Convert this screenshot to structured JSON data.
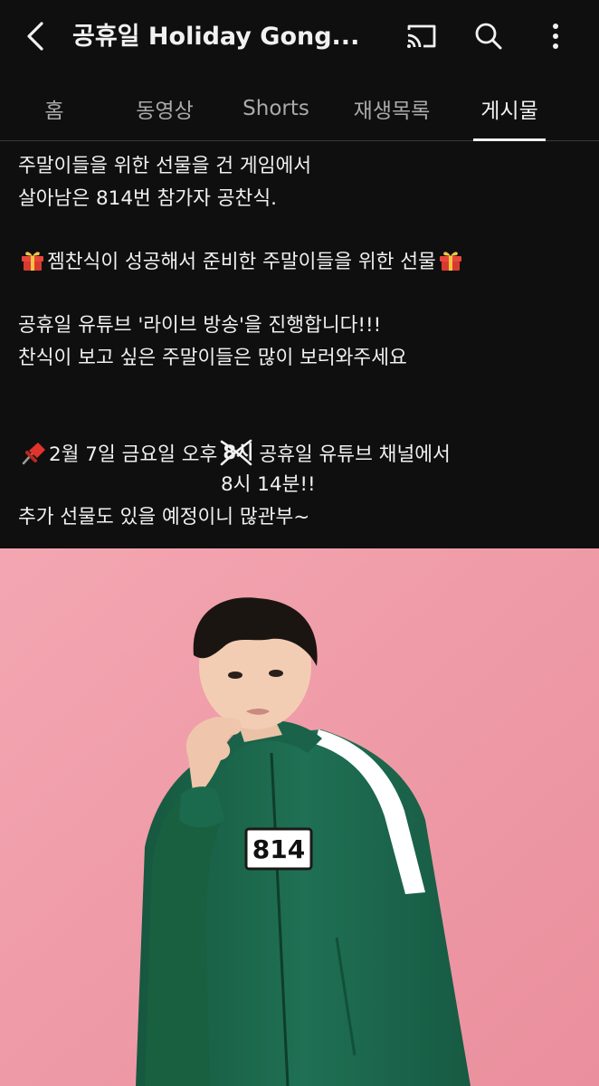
{
  "appbar": {
    "title": "공휴일 Holiday Gong...",
    "icons": [
      "back-arrow-icon",
      "cast-icon",
      "search-icon",
      "more-vert-icon"
    ]
  },
  "tabs": [
    {
      "label": "홈",
      "active": false
    },
    {
      "label": "동영상",
      "active": false
    },
    {
      "label": "Shorts",
      "active": false
    },
    {
      "label": "재생목록",
      "active": false
    },
    {
      "label": "게시물",
      "active": true
    }
  ],
  "post": {
    "line1": "주말이들을 위한 선물을 건 게임에서",
    "line2": "살아남은 814번 참가자 공찬식.",
    "line3": "젬찬식이 성공해서 준비한 주말이들을 위한 선물",
    "line4": "공휴일 유튜브 '라이브 방송'을 진행합니다!!!",
    "line5": "찬식이 보고 싶은 주말이들은 많이 보러와주세요",
    "line6_before": "2월 7일 금요일 오후",
    "line6_struck": "8시",
    "line6_after": "공휴일 유튜브 채널에서",
    "line7": "8시 14분!!",
    "line8": "추가 선물도 있을 예정이니 많관부~",
    "emojis": [
      "gift-icon",
      "pushpin-icon"
    ]
  },
  "photo": {
    "jersey_number": "814",
    "colors": {
      "background": "#f0a0ac",
      "jacket": "#1e6b50",
      "stripe": "#ffffff"
    }
  },
  "colors": {
    "app_background": "#0f0f0f",
    "text_primary": "#f1f1f1",
    "text_secondary": "#aaaaaa"
  }
}
